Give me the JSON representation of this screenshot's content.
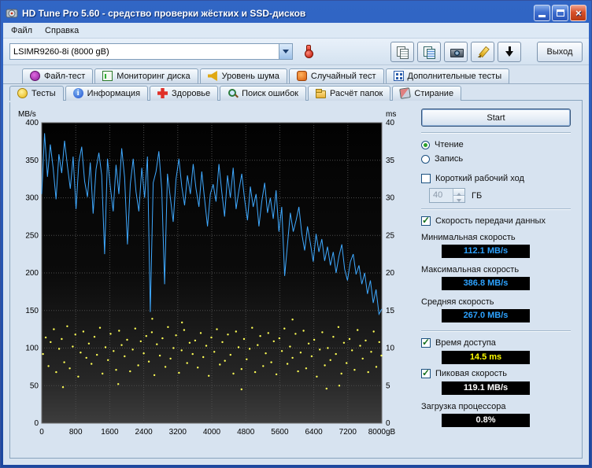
{
  "window": {
    "title": "HD Tune Pro 5.60 - средство проверки жёстких и SSD-дисков",
    "buttons": [
      "minimize-icon",
      "maximize-icon",
      "close-icon"
    ]
  },
  "menu": {
    "items": [
      {
        "name": "file",
        "label": "Файл"
      },
      {
        "name": "help",
        "label": "Справка"
      }
    ]
  },
  "toolbar": {
    "drive_select": "LSIMR9260-8i (8000 gB)",
    "exit_label": "Выход",
    "icons": [
      "thermometer-icon",
      "copy-pages-icon",
      "copy-image-icon",
      "camera-icon",
      "pen-icon",
      "save-arrow-icon"
    ]
  },
  "tabs": {
    "top": [
      {
        "name": "file-test",
        "icon": "gauge-icon",
        "label": "Файл-тест"
      },
      {
        "name": "disk-monitor",
        "icon": "monitor-icon",
        "label": "Мониторинг диска"
      },
      {
        "name": "noise-level",
        "icon": "speaker-icon",
        "label": "Уровень шума"
      },
      {
        "name": "random-test",
        "icon": "random-icon",
        "label": "Случайный тест"
      },
      {
        "name": "extra-tests",
        "icon": "extra-icon",
        "label": "Дополнительные тесты"
      }
    ],
    "bottom": [
      {
        "name": "tests",
        "icon": "bulb-icon",
        "label": "Тесты"
      },
      {
        "name": "info",
        "icon": "info-icon",
        "label": "Информация"
      },
      {
        "name": "health",
        "icon": "health-icon",
        "label": "Здоровье"
      },
      {
        "name": "error-scan",
        "icon": "search-icon",
        "label": "Поиск ошибок"
      },
      {
        "name": "folder-usage",
        "icon": "folder-icon",
        "label": "Расчёт папок"
      },
      {
        "name": "erase",
        "icon": "erase-icon",
        "label": "Стирание"
      }
    ],
    "active": "Тесты"
  },
  "controls": {
    "start_label": "Start",
    "read_label": "Чтение",
    "read_selected": true,
    "write_label": "Запись",
    "write_selected": false,
    "short_stroke_label": "Короткий рабочий ход",
    "short_stroke_checked": false,
    "short_stroke_value": "40",
    "short_stroke_unit": "ГБ",
    "transfer_label": "Скорость передачи данных",
    "transfer_checked": true,
    "min_speed_label": "Минимальная скорость",
    "min_speed_value": "112.1 MB/s",
    "max_speed_label": "Максимальная скорость",
    "max_speed_value": "386.8 MB/s",
    "avg_speed_label": "Средняя скорость",
    "avg_speed_value": "267.0 MB/s",
    "access_time_label": "Время доступа",
    "access_time_checked": true,
    "access_time_value": "14.5 ms",
    "burst_label": "Пиковая скорость",
    "burst_checked": true,
    "burst_value": "119.1 MB/s",
    "cpu_label": "Загрузка процессора",
    "cpu_value": "0.8%"
  },
  "colors": {
    "speed": "#2da2ff",
    "access": "#ffff00",
    "plain": "#ffffff"
  },
  "chart_data": {
    "type": "line",
    "title": "",
    "grid": true,
    "left_axis": {
      "label": "MB/s",
      "min": 0,
      "max": 400,
      "step": 50
    },
    "right_axis": {
      "label": "ms",
      "min": 0,
      "max": 40,
      "step": 5
    },
    "x_axis": {
      "min": 0,
      "max": 8000,
      "step": 800,
      "max_label": "8000gB"
    },
    "series": [
      {
        "name": "transfer-rate",
        "type": "line",
        "axis": "left",
        "unit": "MB/s",
        "color": "#3fa9ff",
        "values": [
          305,
          386,
          328,
          371,
          340,
          298,
          358,
          333,
          376,
          342,
          312,
          355,
          285,
          348,
          368,
          322,
          301,
          347,
          279,
          338,
          360,
          330,
          225,
          352,
          315,
          282,
          344,
          305,
          366,
          327,
          238,
          318,
          352,
          308,
          282,
          340,
          300,
          355,
          148,
          320,
          335,
          362,
          310,
          185,
          332,
          300,
          268,
          325,
          352,
          315,
          290,
          330,
          305,
          345,
          312,
          288,
          335,
          298,
          262,
          305,
          318,
          295,
          345,
          308,
          275,
          330,
          300,
          340,
          285,
          310,
          332,
          298,
          270,
          315,
          288,
          305,
          262,
          295,
          320,
          280,
          300,
          272,
          310,
          255,
          288,
          196,
          238,
          280,
          255,
          270,
          288,
          252,
          230,
          262,
          240,
          215,
          252,
          228,
          245,
          216,
          235,
          210,
          228,
          200,
          222,
          238,
          205,
          190,
          215,
          225,
          198,
          210,
          185,
          200,
          172,
          190,
          160,
          178,
          145,
          152
        ]
      },
      {
        "name": "access-time",
        "type": "scatter",
        "axis": "right",
        "unit": "ms",
        "color": "#ffff55",
        "points": [
          [
            30,
            9.2
          ],
          [
            95,
            11.4
          ],
          [
            160,
            7.6
          ],
          [
            210,
            10.8
          ],
          [
            285,
            12.5
          ],
          [
            340,
            6.8
          ],
          [
            410,
            9.9
          ],
          [
            470,
            11.2
          ],
          [
            530,
            8.1
          ],
          [
            600,
            12.9
          ],
          [
            660,
            7.3
          ],
          [
            730,
            10.2
          ],
          [
            790,
            11.8
          ],
          [
            860,
            6.2
          ],
          [
            915,
            9.4
          ],
          [
            980,
            12.2
          ],
          [
            1050,
            8.7
          ],
          [
            1110,
            10.6
          ],
          [
            1170,
            7.9
          ],
          [
            1240,
            11.5
          ],
          [
            1300,
            9.1
          ],
          [
            1370,
            12.7
          ],
          [
            1430,
            6.6
          ],
          [
            1500,
            10.1
          ],
          [
            1560,
            8.4
          ],
          [
            1620,
            11.9
          ],
          [
            1690,
            9.6
          ],
          [
            1750,
            7.1
          ],
          [
            1820,
            12.3
          ],
          [
            1880,
            10.4
          ],
          [
            1950,
            8.9
          ],
          [
            2010,
            11.1
          ],
          [
            2080,
            6.9
          ],
          [
            2140,
            9.8
          ],
          [
            2200,
            12.6
          ],
          [
            2270,
            7.7
          ],
          [
            2330,
            10.9
          ],
          [
            2400,
            9.3
          ],
          [
            2460,
            11.6
          ],
          [
            2520,
            8.2
          ],
          [
            2590,
            12.1
          ],
          [
            2650,
            6.4
          ],
          [
            2710,
            10.5
          ],
          [
            2780,
            9.0
          ],
          [
            2840,
            11.3
          ],
          [
            2910,
            7.5
          ],
          [
            2970,
            12.8
          ],
          [
            3030,
            8.6
          ],
          [
            3100,
            10.0
          ],
          [
            3160,
            11.7
          ],
          [
            3230,
            6.7
          ],
          [
            3290,
            9.7
          ],
          [
            3350,
            12.4
          ],
          [
            3420,
            8.0
          ],
          [
            3480,
            10.7
          ],
          [
            3550,
            9.2
          ],
          [
            3610,
            11.0
          ],
          [
            3670,
            7.4
          ],
          [
            3740,
            12.0
          ],
          [
            3800,
            8.8
          ],
          [
            3870,
            10.3
          ],
          [
            3930,
            6.3
          ],
          [
            3990,
            11.4
          ],
          [
            4060,
            9.5
          ],
          [
            4120,
            12.5
          ],
          [
            4190,
            7.8
          ],
          [
            4250,
            10.8
          ],
          [
            4310,
            8.3
          ],
          [
            4380,
            11.8
          ],
          [
            4440,
            9.1
          ],
          [
            4510,
            6.6
          ],
          [
            4570,
            12.2
          ],
          [
            4630,
            10.1
          ],
          [
            4700,
            7.2
          ],
          [
            4760,
            11.2
          ],
          [
            4820,
            8.5
          ],
          [
            4890,
            9.9
          ],
          [
            4950,
            12.7
          ],
          [
            5020,
            6.8
          ],
          [
            5080,
            10.4
          ],
          [
            5140,
            11.6
          ],
          [
            5210,
            7.6
          ],
          [
            5270,
            9.3
          ],
          [
            5330,
            12.0
          ],
          [
            5400,
            8.1
          ],
          [
            5460,
            10.9
          ],
          [
            5520,
            6.5
          ],
          [
            5590,
            11.3
          ],
          [
            5650,
            9.6
          ],
          [
            5710,
            12.6
          ],
          [
            5780,
            7.9
          ],
          [
            5840,
            10.2
          ],
          [
            5900,
            8.7
          ],
          [
            5970,
            11.9
          ],
          [
            6030,
            6.9
          ],
          [
            6090,
            9.4
          ],
          [
            6160,
            12.3
          ],
          [
            6220,
            7.3
          ],
          [
            6280,
            10.6
          ],
          [
            6350,
            8.9
          ],
          [
            6410,
            11.1
          ],
          [
            6470,
            6.2
          ],
          [
            6540,
            9.8
          ],
          [
            6600,
            12.1
          ],
          [
            6660,
            7.7
          ],
          [
            6730,
            10.0
          ],
          [
            6790,
            8.4
          ],
          [
            6860,
            11.5
          ],
          [
            6920,
            9.2
          ],
          [
            6980,
            12.8
          ],
          [
            7050,
            6.6
          ],
          [
            7110,
            10.7
          ],
          [
            7170,
            8.0
          ],
          [
            7240,
            11.2
          ],
          [
            7300,
            9.7
          ],
          [
            7360,
            7.1
          ],
          [
            7430,
            12.4
          ],
          [
            7490,
            10.3
          ],
          [
            7550,
            8.6
          ],
          [
            7620,
            11.0
          ],
          [
            7680,
            6.8
          ],
          [
            7750,
            9.5
          ],
          [
            7810,
            12.2
          ],
          [
            7870,
            7.5
          ],
          [
            7940,
            10.8
          ],
          [
            7990,
            9.0
          ],
          [
            500,
            4.8
          ],
          [
            1800,
            5.2
          ],
          [
            3300,
            13.4
          ],
          [
            4700,
            4.5
          ],
          [
            5900,
            13.8
          ],
          [
            7000,
            5.0
          ],
          [
            2600,
            13.9
          ],
          [
            6700,
            4.6
          ]
        ]
      }
    ]
  }
}
